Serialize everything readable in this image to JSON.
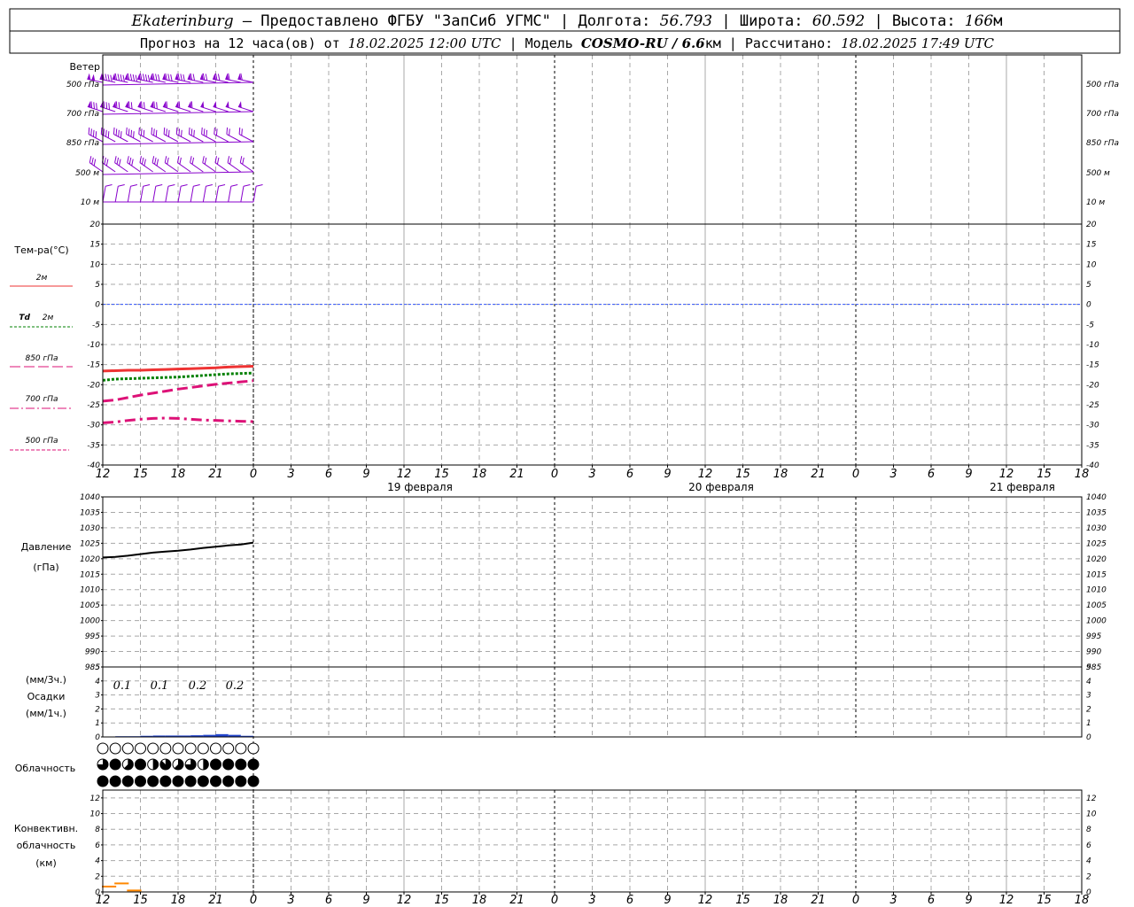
{
  "header": {
    "station": "Ekaterinburg",
    "provider": " – Предоставлено ФГБУ \"ЗапСиб УГМС\" | Долгота: ",
    "lon": "56.793",
    "lat_label": " | Широта: ",
    "lat": "60.592",
    "alt_label": " | Высота: ",
    "alt": "166",
    "alt_unit": "м",
    "line2_a": "Прогноз на 12 часа(ов) от ",
    "run": "18.02.2025 12:00 UTC",
    "line2_b": "  | Модель ",
    "model": "COSMO-RU / 6.6",
    "model_unit": "км",
    "line2_c": " | Рассчитано: ",
    "calc": "18.02.2025 17:49 UTC"
  },
  "labels": {
    "wind": "Ветер",
    "wind_levels": [
      "500 гПа",
      "700 гПа",
      "850 гПа",
      "500  м",
      "10   м"
    ],
    "temp_title": "Тем-ра(°C)",
    "temp_2m": "2м",
    "td_prefix": "Td",
    "td_2m": "2м",
    "t850": "850 гПа",
    "t700": "700 гПа",
    "t500": "500 гПа",
    "pressure_a": "Давление",
    "pressure_b": "(гПа)",
    "precip_a": "(мм/3ч.)",
    "precip_b": "Осадки",
    "precip_c": "(мм/1ч.)",
    "cloud": "Облачность",
    "conv_a": "Конвективн.",
    "conv_b": "облачность",
    "conv_c": "(км)",
    "dates": [
      "19 февраля",
      "20 февраля",
      "21 февраля"
    ]
  },
  "colors": {
    "t2m": "#ee3333",
    "td2m": "#008000",
    "t850": "#dd1177",
    "t700": "#dd1177",
    "t500": "#dd1177",
    "zero": "#3355ff",
    "pressure": "#000000",
    "precip": "#2244cc",
    "wind": "#8800cc",
    "conv": "#ff8800"
  },
  "chart_data": [
    {
      "type": "line",
      "name": "temperature",
      "x_hours": [
        0,
        1,
        2,
        3,
        4,
        5,
        6,
        7,
        8,
        9,
        10,
        11,
        12
      ],
      "x_tick_labels": [
        "12",
        "15",
        "18",
        "21",
        "0",
        "3",
        "6",
        "9",
        "12",
        "15",
        "18",
        "21",
        "0",
        "3",
        "6",
        "9",
        "12",
        "15",
        "18",
        "21",
        "0",
        "3",
        "6",
        "9",
        "12",
        "15",
        "18"
      ],
      "ylim": [
        -40,
        20
      ],
      "yticks": [
        20,
        15,
        10,
        5,
        0,
        -5,
        -10,
        -15,
        -20,
        -25,
        -30,
        -35,
        -40
      ],
      "series": [
        {
          "name": "2м",
          "values": [
            -16.6,
            -16.5,
            -16.4,
            -16.4,
            -16.3,
            -16.2,
            -16.1,
            -16.0,
            -15.9,
            -15.8,
            -15.6,
            -15.5,
            -15.4
          ]
        },
        {
          "name": "Td 2м",
          "values": [
            -18.9,
            -18.6,
            -18.5,
            -18.4,
            -18.3,
            -18.2,
            -18.1,
            -17.9,
            -17.7,
            -17.5,
            -17.3,
            -17.2,
            -17.1
          ]
        },
        {
          "name": "850 гПа",
          "values": [
            -24.1,
            -23.8,
            -23.2,
            -22.6,
            -22.1,
            -21.6,
            -21.1,
            -20.7,
            -20.3,
            -19.9,
            -19.6,
            -19.3,
            -19.0
          ]
        },
        {
          "name": "700 гПа",
          "values": [
            -29.5,
            -29.3,
            -28.9,
            -28.6,
            -28.4,
            -28.3,
            -28.4,
            -28.6,
            -28.8,
            -28.9,
            -29.0,
            -29.1,
            -29.2
          ]
        }
      ]
    },
    {
      "type": "line",
      "name": "pressure",
      "x_hours": [
        0,
        1,
        2,
        3,
        4,
        5,
        6,
        7,
        8,
        9,
        10,
        11,
        12
      ],
      "ylim": [
        985,
        1040
      ],
      "yticks": [
        1040,
        1035,
        1030,
        1025,
        1020,
        1015,
        1010,
        1005,
        1000,
        995,
        990,
        985
      ],
      "values": [
        1020.4,
        1020.6,
        1021.0,
        1021.5,
        1022.0,
        1022.3,
        1022.6,
        1023.0,
        1023.5,
        1023.9,
        1024.3,
        1024.6,
        1025.2
      ]
    },
    {
      "type": "bar",
      "name": "precipitation",
      "ylim": [
        0,
        5
      ],
      "yticks": [
        5,
        4,
        3,
        2,
        1,
        0
      ],
      "totals_3h": [
        "0.1",
        "0.1",
        "0.2",
        "0.2"
      ],
      "x_hours": [
        0,
        1,
        2,
        3,
        4,
        5,
        6,
        7,
        8,
        9,
        10,
        11
      ],
      "values": [
        0.0,
        0.05,
        0.05,
        0.08,
        0.1,
        0.1,
        0.1,
        0.12,
        0.15,
        0.2,
        0.15,
        0.08
      ]
    },
    {
      "type": "bar",
      "name": "convective_cloud",
      "ylim": [
        0,
        13
      ],
      "yticks": [
        12,
        10,
        8,
        6,
        4,
        2,
        0
      ],
      "x_hours": [
        0,
        1,
        2
      ],
      "values": [
        0.8,
        1.2,
        0.3
      ]
    },
    {
      "type": "table",
      "name": "cloud_cover",
      "rows": [
        [
          "0",
          "0",
          "0",
          "0",
          "0",
          "0",
          "0",
          "0",
          "0",
          "0",
          "0",
          "0",
          "0"
        ],
        [
          "6",
          "8",
          "5",
          "8",
          "4",
          "7",
          "5",
          "6",
          "4",
          "8",
          "8",
          "8",
          "8"
        ],
        [
          "8",
          "8",
          "8",
          "8",
          "8",
          "8",
          "8",
          "8",
          "8",
          "8",
          "8",
          "8",
          "8"
        ]
      ]
    },
    {
      "type": "table",
      "name": "wind_barbs",
      "levels": [
        "500 гПа",
        "700 гПа",
        "850 гПа",
        "500  м",
        "10   м"
      ],
      "speed_ms": [
        [
          50,
          45,
          45,
          45,
          45,
          40,
          40,
          40,
          35,
          35,
          35,
          30,
          30
        ],
        [
          40,
          40,
          35,
          35,
          35,
          35,
          30,
          30,
          30,
          25,
          25,
          25,
          25
        ],
        [
          20,
          20,
          20,
          20,
          15,
          15,
          15,
          15,
          15,
          15,
          10,
          10,
          10
        ],
        [
          15,
          15,
          15,
          15,
          15,
          15,
          10,
          10,
          10,
          10,
          10,
          10,
          10
        ],
        [
          5,
          5,
          5,
          5,
          5,
          5,
          5,
          5,
          5,
          5,
          5,
          5,
          5
        ]
      ]
    }
  ]
}
